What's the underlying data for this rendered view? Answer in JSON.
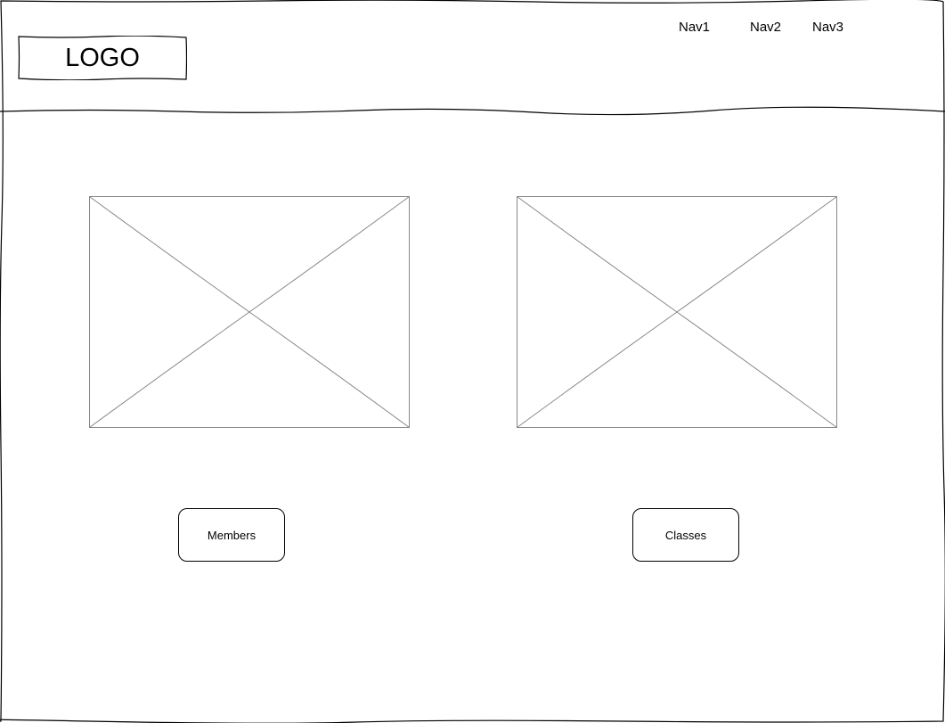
{
  "header": {
    "logo_text": "LOGO",
    "nav": [
      {
        "label": "Nav1"
      },
      {
        "label": "Nav2"
      },
      {
        "label": "Nav3"
      }
    ]
  },
  "main": {
    "cards": [
      {
        "button_label": "Members"
      },
      {
        "button_label": "Classes"
      }
    ]
  }
}
